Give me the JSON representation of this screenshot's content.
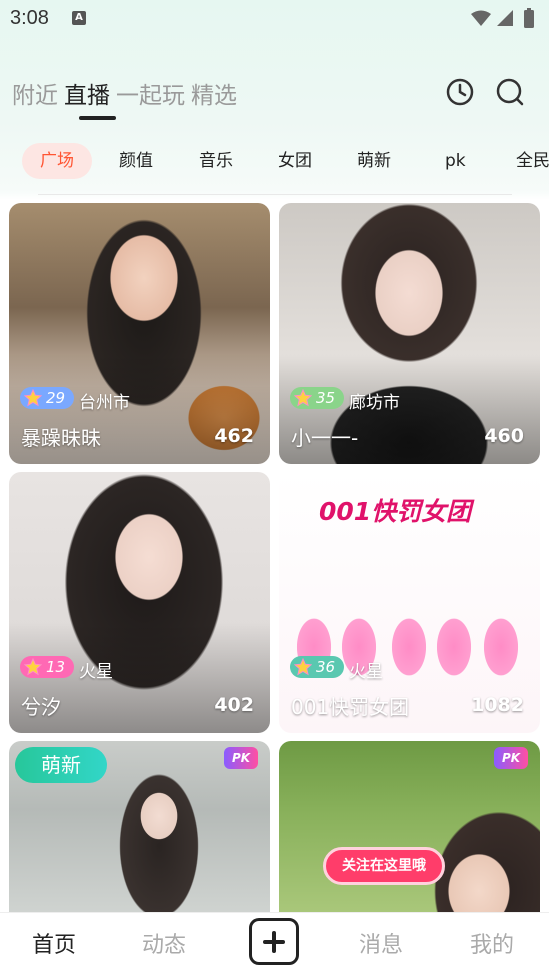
{
  "status_bar": {
    "time": "3:08",
    "notification_letter": "A"
  },
  "top_tabs": [
    {
      "label": "附近",
      "active": false
    },
    {
      "label": "直播",
      "active": true
    },
    {
      "label": "一起玩",
      "active": false
    },
    {
      "label": "精选",
      "active": false
    }
  ],
  "header_icons": [
    "history-icon",
    "search-icon"
  ],
  "categories": [
    "广场",
    "颜值",
    "音乐",
    "女团",
    "萌新",
    "pk",
    "全民"
  ],
  "active_category": "广场",
  "cards": [
    {
      "level": "29",
      "level_color": "#7aa8ff",
      "city": "台州市",
      "name": "暴躁昧昧",
      "count": "462"
    },
    {
      "level": "35",
      "level_color": "#8ad48a",
      "city": "廊坊市",
      "name": "小一一-",
      "count": "460"
    },
    {
      "level": "13",
      "level_color": "#ff69b4",
      "city": "火星",
      "name": "兮汐",
      "count": "402"
    },
    {
      "level": "36",
      "level_color": "#5ac8b0",
      "city": "火星",
      "name": "001快罚女团",
      "count": "1082",
      "poster_title": "001快罚女团"
    },
    {
      "tag": "萌新",
      "badge": "PK"
    },
    {
      "badge": "PK",
      "banner": "关注在这里哦"
    }
  ],
  "bottom_nav": {
    "home": "首页",
    "feed": "动态",
    "messages": "消息",
    "me": "我的"
  },
  "colors": {
    "accent": "#ff5533",
    "new_tag": "#27c79a",
    "pk": "#ff4fa3"
  }
}
